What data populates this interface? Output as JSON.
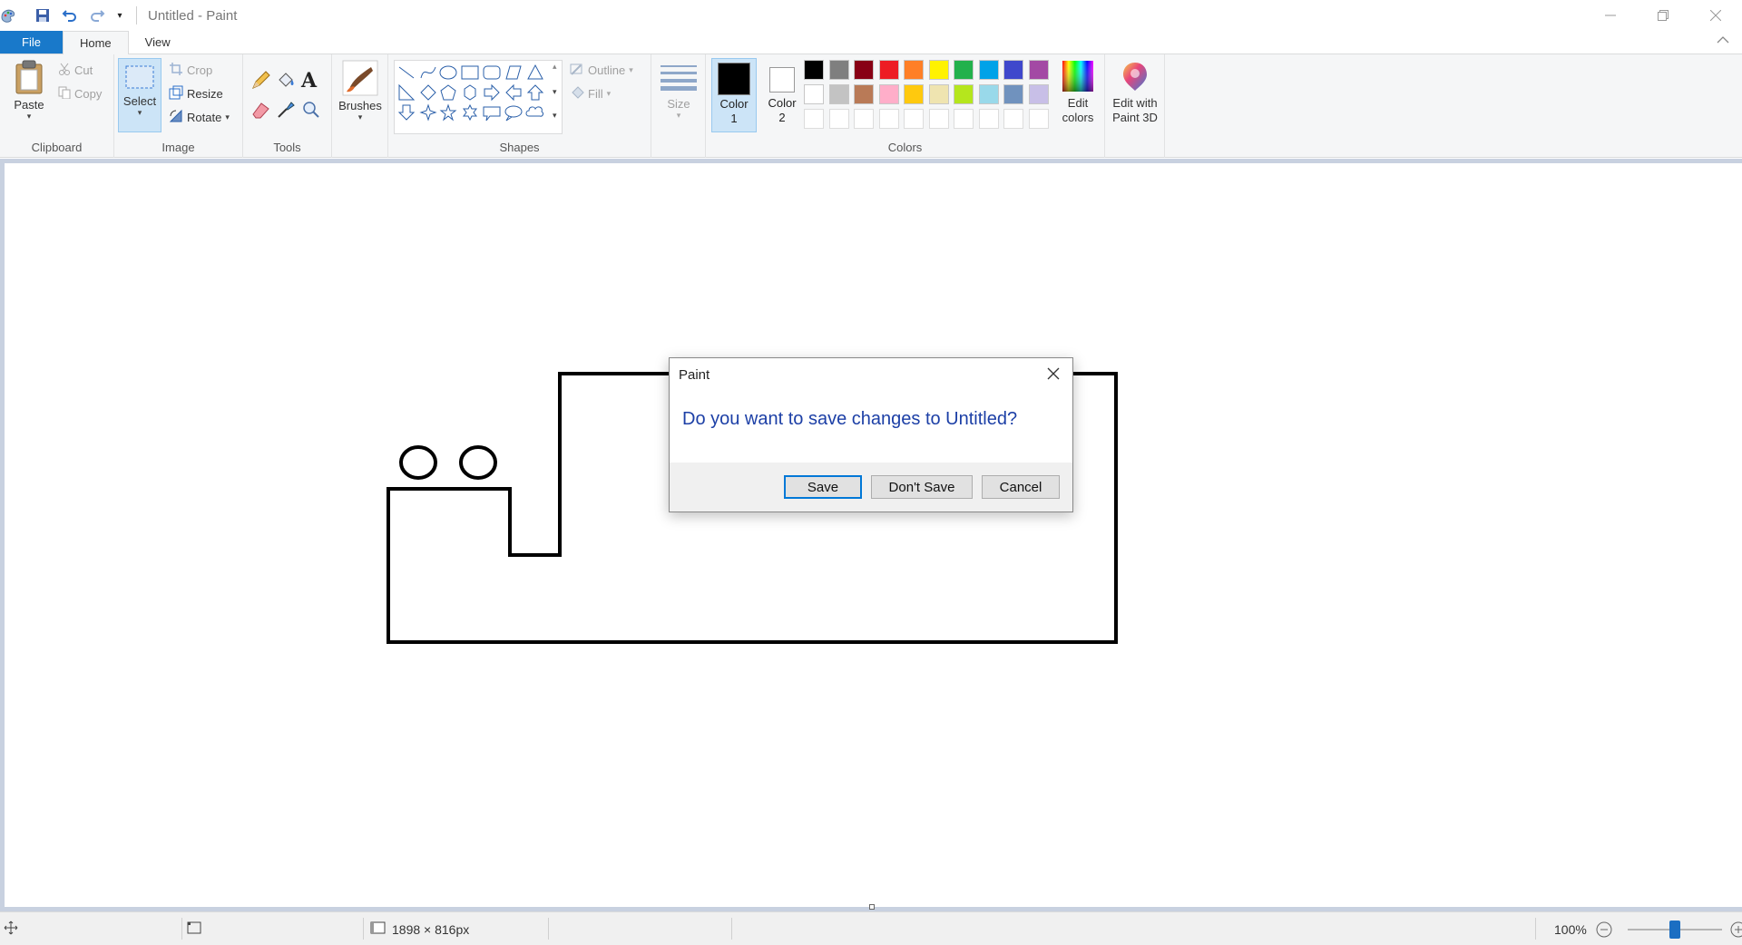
{
  "window": {
    "title": "Untitled - Paint",
    "controls": [
      "minimize",
      "restore",
      "close"
    ]
  },
  "ribbon_tabs": {
    "file": "File",
    "home": "Home",
    "view": "View"
  },
  "clipboard": {
    "paste": "Paste",
    "cut": "Cut",
    "copy": "Copy",
    "group_label": "Clipboard"
  },
  "image": {
    "select": "Select",
    "crop": "Crop",
    "resize": "Resize",
    "rotate": "Rotate",
    "group_label": "Image"
  },
  "tools": {
    "group_label": "Tools",
    "items": [
      "pencil-icon",
      "fill-icon",
      "text-icon",
      "eraser-icon",
      "color-picker-icon",
      "magnifier-icon"
    ]
  },
  "brushes": {
    "label": "Brushes"
  },
  "shapes": {
    "outline": "Outline",
    "fill": "Fill",
    "group_label": "Shapes"
  },
  "size": {
    "label": "Size"
  },
  "colors": {
    "color1_label_1": "Color",
    "color1_label_2": "1",
    "color2_label_1": "Color",
    "color2_label_2": "2",
    "color1_value": "#000000",
    "color2_value": "#ffffff",
    "edit_colors_1": "Edit",
    "edit_colors_2": "colors",
    "group_label": "Colors",
    "palette_row1": [
      "#000000",
      "#7f7f7f",
      "#880015",
      "#ed1c24",
      "#ff7f27",
      "#fff200",
      "#22b14c",
      "#00a2e8",
      "#3f48cc",
      "#a349a4"
    ],
    "palette_row2": [
      "#ffffff",
      "#c3c3c3",
      "#b97a57",
      "#ffaec9",
      "#ffc90e",
      "#efe4b0",
      "#b5e61d",
      "#99d9ea",
      "#7092be",
      "#c8bfe7"
    ]
  },
  "paint3d": {
    "line1": "Edit with",
    "line2": "Paint 3D"
  },
  "dialog": {
    "title": "Paint",
    "message": "Do you want to save changes to Untitled?",
    "save": "Save",
    "dont_save": "Don't Save",
    "cancel": "Cancel"
  },
  "statusbar": {
    "canvas_size": "1898 × 816px",
    "zoom": "100%"
  }
}
